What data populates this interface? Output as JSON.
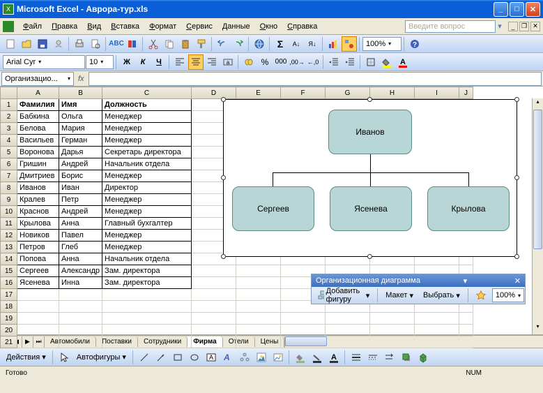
{
  "window": {
    "app": "Microsoft Excel",
    "file": "Аврора-тур.xls"
  },
  "help_placeholder": "Введите вопрос",
  "menus": [
    "Файл",
    "Правка",
    "Вид",
    "Вставка",
    "Формат",
    "Сервис",
    "Данные",
    "Окно",
    "Справка"
  ],
  "zoom": "100%",
  "font": {
    "name": "Arial Cyr",
    "size": "10"
  },
  "namebox": "Организацио...",
  "formula": "",
  "columns": [
    "A",
    "B",
    "C",
    "D",
    "E",
    "F",
    "G",
    "H",
    "I",
    "J"
  ],
  "rows": 21,
  "table": {
    "headers": [
      "Фамилия",
      "Имя",
      "Должность"
    ],
    "data": [
      [
        "Бабкина",
        "Ольга",
        "Менеджер"
      ],
      [
        "Белова",
        "Мария",
        "Менеджер"
      ],
      [
        "Васильев",
        "Герман",
        "Менеджер"
      ],
      [
        "Воронова",
        "Дарья",
        "Секретарь директора"
      ],
      [
        "Гришин",
        "Андрей",
        "Начальник отдела"
      ],
      [
        "Дмитриев",
        "Борис",
        "Менеджер"
      ],
      [
        "Иванов",
        "Иван",
        "Директор"
      ],
      [
        "Кралев",
        "Петр",
        "Менеджер"
      ],
      [
        "Краснов",
        "Андрей",
        "Менеджер"
      ],
      [
        "Крылова",
        "Анна",
        "Главный бухгалтер"
      ],
      [
        "Новиков",
        "Павел",
        "Менеджер"
      ],
      [
        "Петров",
        "Глеб",
        "Менеджер"
      ],
      [
        "Попова",
        "Анна",
        "Начальник отдела"
      ],
      [
        "Сергеев",
        "Александр",
        "Зам. директора"
      ],
      [
        "Ясенева",
        "Инна",
        "Зам. директора"
      ]
    ]
  },
  "chart_data": {
    "type": "org-chart",
    "root": "Иванов",
    "children": [
      "Сергеев",
      "Ясенева",
      "Крылова"
    ]
  },
  "org_toolbar": {
    "title": "Организационная диаграмма",
    "add_shape": "Добавить фигуру",
    "layout": "Макет",
    "select": "Выбрать",
    "zoom": "100%"
  },
  "tabs": [
    "Автомобили",
    "Поставки",
    "Сотрудники",
    "Фирма",
    "Отели",
    "Цены"
  ],
  "active_tab": 3,
  "drawbar": {
    "actions": "Действия",
    "autoshapes": "Автофигуры"
  },
  "status": {
    "ready": "Готово",
    "num": "NUM"
  },
  "colors": {
    "accent_node": "#b8d6d6",
    "titlebar": "#0a5ed8"
  }
}
